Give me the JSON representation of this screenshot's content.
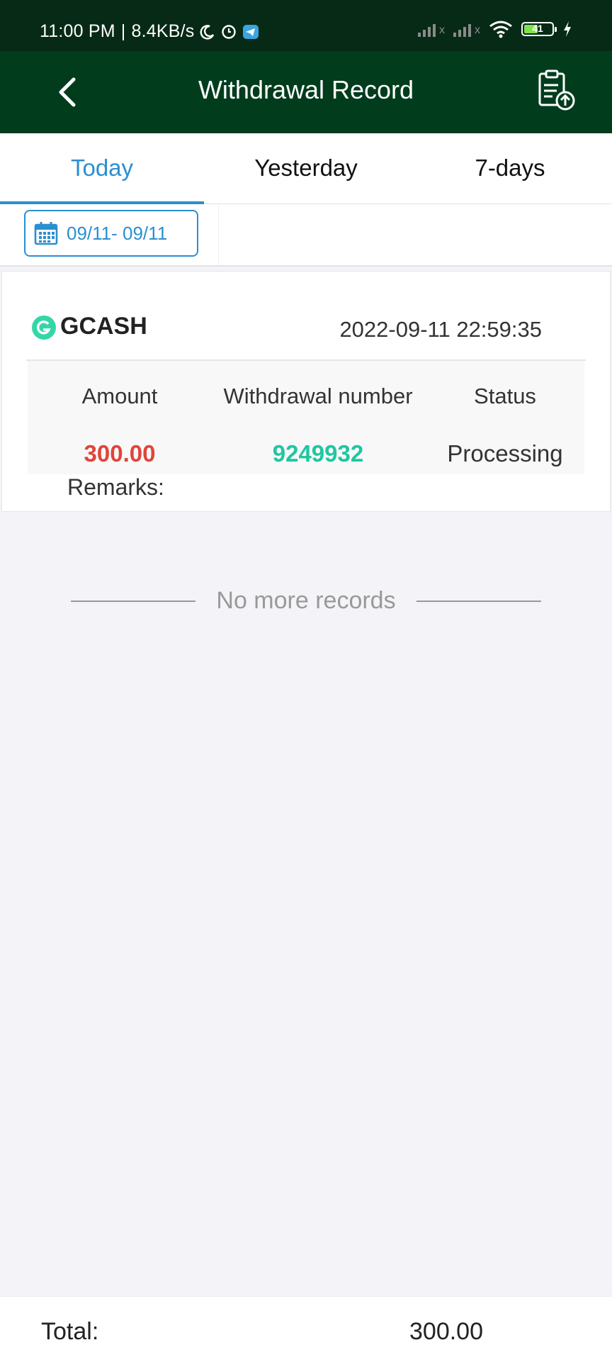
{
  "status_bar": {
    "time": "11:00 PM",
    "separator": "|",
    "net_speed": "8.4KB/s",
    "battery_level": "41",
    "icons": [
      "moon-icon",
      "alarm-icon",
      "telegram-icon",
      "signal-icon",
      "signal-icon",
      "wifi-icon",
      "battery-icon",
      "charging-icon"
    ]
  },
  "header": {
    "title": "Withdrawal Record",
    "back_icon": "chevron-left-icon",
    "action_icon": "clipboard-upload-icon"
  },
  "tabs": [
    {
      "label": "Today",
      "active": true
    },
    {
      "label": "Yesterday",
      "active": false
    },
    {
      "label": "7-days",
      "active": false
    }
  ],
  "filter": {
    "date_range": "09/11- 09/11",
    "icon": "calendar-icon"
  },
  "record": {
    "method": "GCASH",
    "datetime": "2022-09-11 22:59:35",
    "columns": {
      "amount": "Amount",
      "number": "Withdrawal number",
      "status": "Status"
    },
    "amount": "300.00",
    "number": "9249932",
    "status": "Processing",
    "remarks_label": "Remarks:"
  },
  "list_end": {
    "text": "No more records"
  },
  "footer": {
    "total_label": "Total:",
    "total_value": "300.00"
  },
  "colors": {
    "status_bar_bg": "#062a16",
    "header_bg": "#013d1d",
    "accent_blue": "#2a8fd0",
    "amount_red": "#e0453a",
    "number_teal": "#1fc7a0",
    "gcash_green": "#34d6a7"
  }
}
